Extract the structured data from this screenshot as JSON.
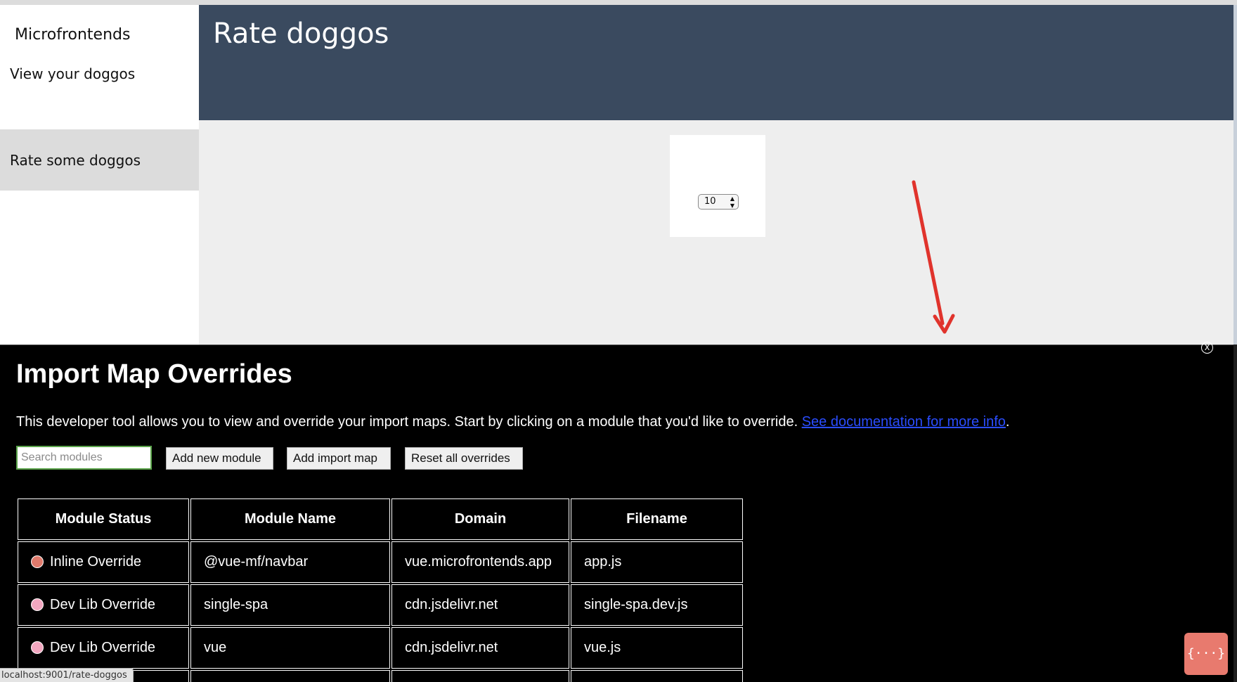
{
  "sidebar": {
    "brand": "Microfrontends",
    "items": [
      {
        "label": "View your doggos"
      },
      {
        "label": "Rate some doggos",
        "active": true
      }
    ]
  },
  "header": {
    "title": "Rate doggos"
  },
  "rating": {
    "value": "10"
  },
  "overrides": {
    "close_glyph": "X",
    "title": "Import Map Overrides",
    "description": "This developer tool allows you to view and override your import maps. Start by clicking on a module that you'd like to override.",
    "doc_link": "See documentation for more info",
    "desc_end": ".",
    "search_placeholder": "Search modules",
    "buttons": {
      "add_module": "Add new module",
      "add_map": "Add import map",
      "reset": "Reset all overrides"
    },
    "table": {
      "headers": [
        "Module Status",
        "Module Name",
        "Domain",
        "Filename"
      ],
      "rows": [
        {
          "status": "Inline Override",
          "status_color": "#e07a6c",
          "name": "@vue-mf/navbar",
          "domain": "vue.microfrontends.app",
          "filename": "app.js"
        },
        {
          "status": "Dev Lib Override",
          "status_color": "#f2a7c0",
          "name": "single-spa",
          "domain": "cdn.jsdelivr.net",
          "filename": "single-spa.dev.js"
        },
        {
          "status": "Dev Lib Override",
          "status_color": "#f2a7c0",
          "name": "vue",
          "domain": "cdn.jsdelivr.net",
          "filename": "vue.js"
        }
      ]
    }
  },
  "fab": {
    "label": "{···}"
  },
  "statusbar": {
    "url": "localhost:9001/rate-doggos"
  },
  "colors": {
    "header_bg": "#3a4a5f",
    "annotation_arrow": "#e0332c",
    "fab_bg": "#e87a6e"
  }
}
